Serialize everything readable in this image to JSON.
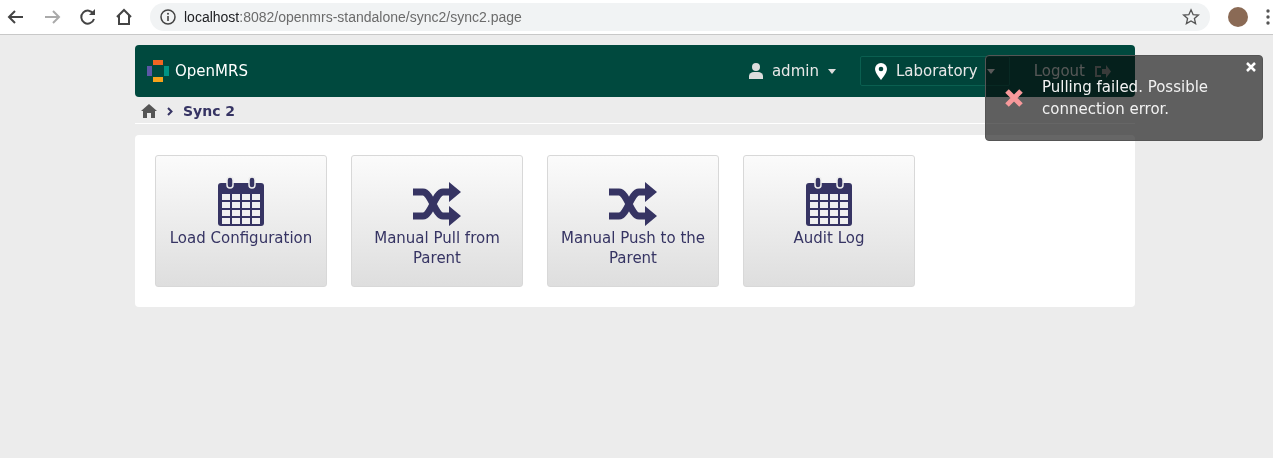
{
  "browser": {
    "nav": [
      {
        "kind": "back",
        "disabled": false
      },
      {
        "kind": "forward",
        "disabled": true
      },
      {
        "kind": "reload",
        "disabled": false
      },
      {
        "kind": "home",
        "disabled": false
      }
    ],
    "url_host": "localhost",
    "url_rest": ":8082/openmrs-standalone/sync2/sync2.page"
  },
  "header": {
    "brand": "OpenMRS",
    "user": "admin",
    "location": "Laboratory",
    "logout": "Logout"
  },
  "breadcrumb": [
    {
      "label": "Sync 2"
    }
  ],
  "tiles": [
    {
      "label": "Load Configuration",
      "kind": "calendar"
    },
    {
      "label": "Manual Pull from Parent",
      "kind": "shuffle"
    },
    {
      "label": "Manual Push to the Parent",
      "kind": "shuffle"
    },
    {
      "label": "Audit Log",
      "kind": "calendar"
    }
  ],
  "toast": {
    "message": "Pulling failed. Possible connection error.",
    "kind": "error"
  }
}
